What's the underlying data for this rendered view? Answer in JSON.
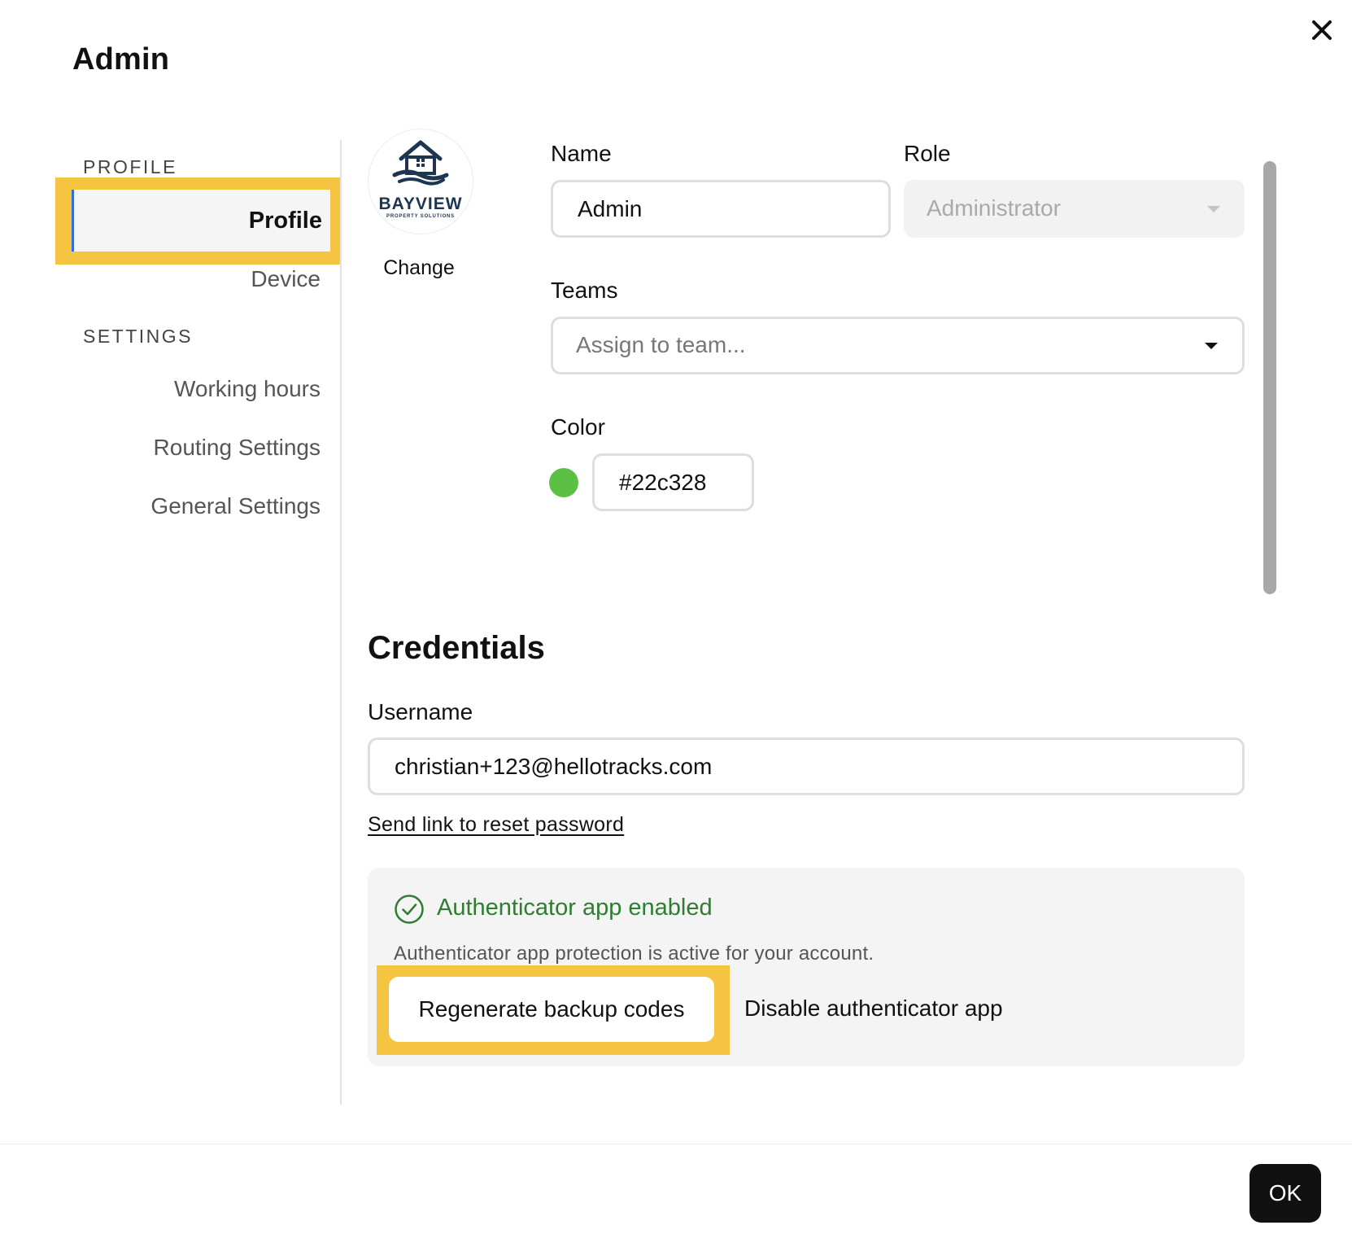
{
  "dialog": {
    "title": "Admin",
    "close_icon": "close-icon"
  },
  "sidebar": {
    "profile_section": "PROFILE",
    "profile_items": [
      {
        "label": "Profile",
        "active": true
      },
      {
        "label": "Device",
        "active": false
      }
    ],
    "settings_section": "SETTINGS",
    "settings_items": [
      {
        "label": "Working hours"
      },
      {
        "label": "Routing Settings"
      },
      {
        "label": "General Settings"
      }
    ]
  },
  "avatar": {
    "brand_name": "BAYVIEW",
    "brand_tagline": "PROPERTY SOLUTIONS",
    "change_label": "Change"
  },
  "form": {
    "name_label": "Name",
    "name_value": "Admin",
    "role_label": "Role",
    "role_value": "Administrator",
    "teams_label": "Teams",
    "teams_placeholder": "Assign to team...",
    "color_label": "Color",
    "color_value": "#22c328",
    "color_swatch": "#5cc044"
  },
  "credentials": {
    "title": "Credentials",
    "username_label": "Username",
    "username_value": "christian+123@hellotracks.com",
    "reset_link": "Send link to reset password",
    "auth_status": "Authenticator app enabled",
    "auth_description": "Authenticator app protection is active for your account.",
    "regenerate_button": "Regenerate backup codes",
    "disable_button": "Disable authenticator app"
  },
  "footer": {
    "ok_button": "OK"
  },
  "colors": {
    "highlight": "#f5c542",
    "active_indicator": "#2f6fe0",
    "success": "#2e7d32"
  }
}
